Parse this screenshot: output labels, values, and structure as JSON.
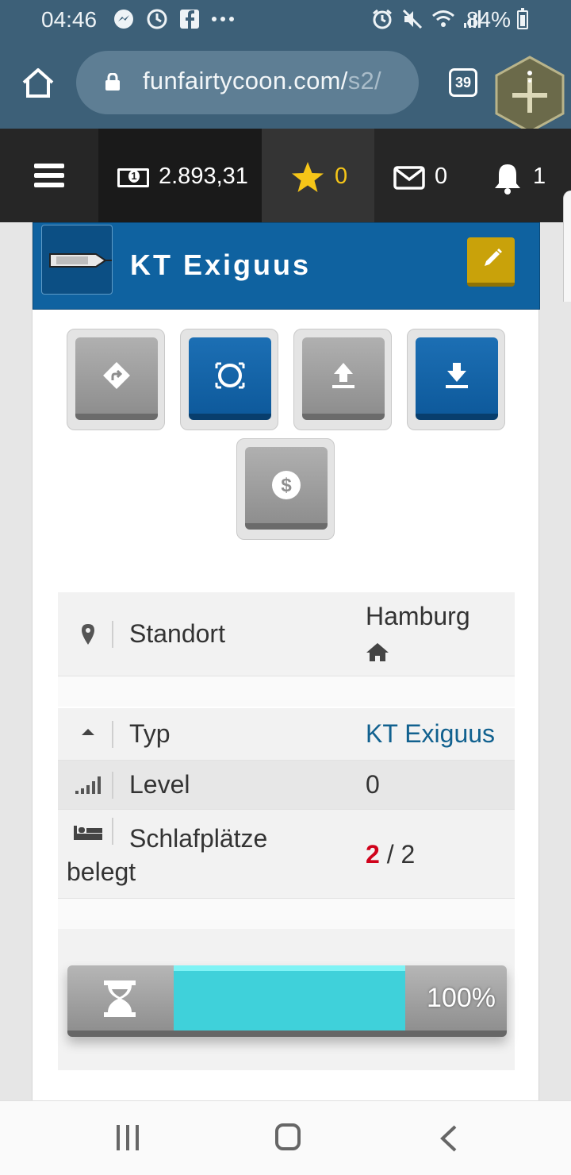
{
  "status_bar": {
    "time": "04:46",
    "battery": "84%",
    "left_icons": [
      "messenger-icon",
      "clock-icon",
      "facebook-icon",
      "more-dots-icon"
    ],
    "right_icons": [
      "alarm-icon",
      "mute-icon",
      "wifi-icon",
      "signal-icon",
      "battery-icon"
    ]
  },
  "browser": {
    "url_main": "funfairtycoon.com/",
    "url_dim": "s2/",
    "tab_count": "39"
  },
  "game_nav": {
    "money": "2.893,31",
    "stars": "0",
    "messages": "0",
    "notifications": "1"
  },
  "card": {
    "title": "KT Exiguus",
    "colors": {
      "header": "#0f62a0",
      "edit": "#c9a20a",
      "progress": "#3fd1da"
    }
  },
  "actions": [
    {
      "name": "directions",
      "style": "gray"
    },
    {
      "name": "ring",
      "style": "blue"
    },
    {
      "name": "upload",
      "style": "gray"
    },
    {
      "name": "download",
      "style": "blue"
    },
    {
      "name": "sell",
      "style": "gray"
    }
  ],
  "location": {
    "label": "Standort",
    "value": "Hamburg"
  },
  "details": {
    "type_label": "Typ",
    "type_value": "KT Exiguus",
    "level_label": "Level",
    "level_value": "0",
    "beds_label_1": "Schlafplätze",
    "beds_label_2": "belegt",
    "beds_used": "2",
    "beds_sep": "/ 2"
  },
  "progress": {
    "value": 1.0,
    "label": "100%"
  }
}
